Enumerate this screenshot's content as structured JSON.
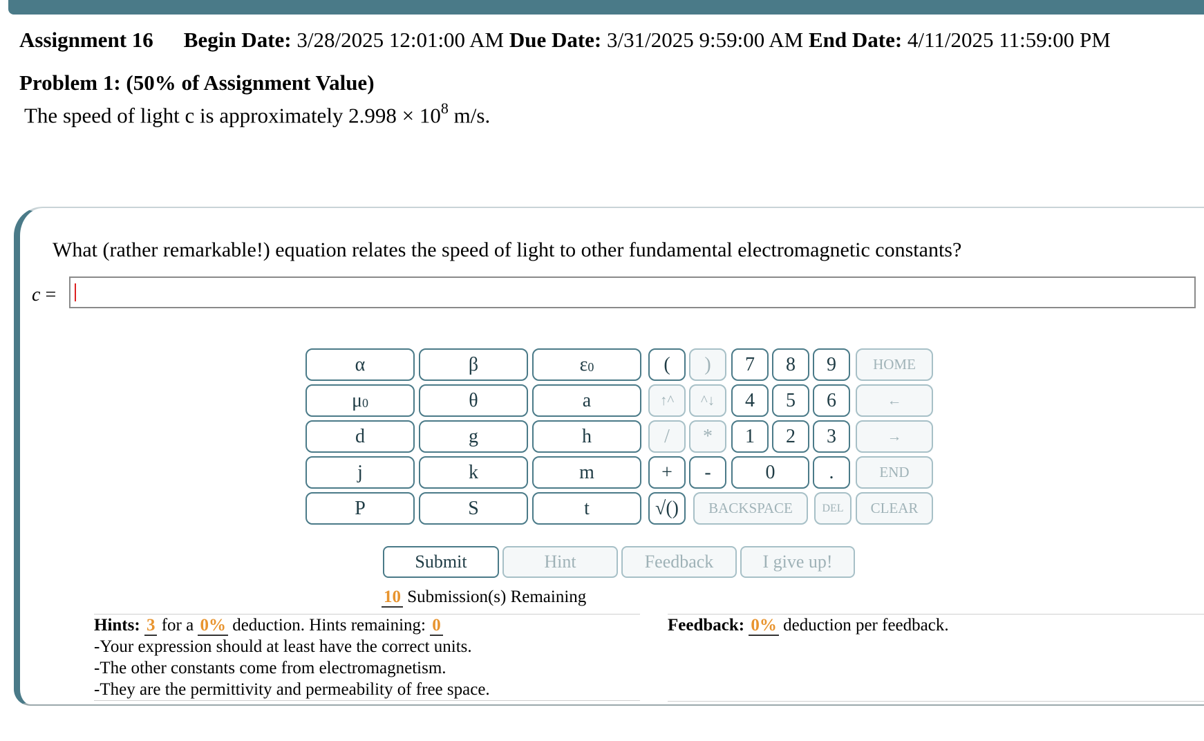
{
  "header": {
    "assignment": "Assignment 16",
    "begin_label": "Begin Date:",
    "begin_value": "3/28/2025 12:01:00 AM",
    "due_label": "Due Date:",
    "due_value": "3/31/2025 9:59:00 AM",
    "end_label": "End Date:",
    "end_value": "4/11/2025 11:59:00 PM"
  },
  "problem": {
    "title": "Problem 1: (50% of Assignment Value)",
    "text_before": "The speed of light c is approximately 2.998 × 10",
    "exponent": "8",
    "text_after": " m/s."
  },
  "question": {
    "text": "What (rather remarkable!) equation relates the speed of light to other fundamental electromagnetic constants?",
    "var": "c",
    "equals": " =",
    "answer_value": ""
  },
  "keypad": {
    "alpha": "α",
    "beta": "β",
    "eps": "ε",
    "eps_sub": "0",
    "mu": "μ",
    "mu_sub": "0",
    "theta": "θ",
    "a": "a",
    "d": "d",
    "g": "g",
    "h": "h",
    "j": "j",
    "k": "k",
    "m": "m",
    "P": "P",
    "S": "S",
    "t": "t",
    "lparen": "(",
    "rparen": ")",
    "up": "↑^",
    "down": "^↓",
    "slash": "/",
    "star": "*",
    "plus": "+",
    "minus": "-",
    "sqrt": "√()",
    "n7": "7",
    "n8": "8",
    "n9": "9",
    "n4": "4",
    "n5": "5",
    "n6": "6",
    "n1": "1",
    "n2": "2",
    "n3": "3",
    "n0": "0",
    "dot": ".",
    "home": "HOME",
    "left": "←",
    "right": "→",
    "end": "END",
    "backspace": "BACKSPACE",
    "del": "DEL",
    "clear": "CLEAR"
  },
  "buttons": {
    "submit": "Submit",
    "hint": "Hint",
    "feedback": "Feedback",
    "giveup": "I give up!"
  },
  "remaining": {
    "count": "10",
    "label": " Submission(s) Remaining"
  },
  "hints": {
    "label": "Hints:",
    "count": "3",
    "for_a": " for a ",
    "pct": "0%",
    "deduction": " deduction. Hints remaining: ",
    "remaining": "0",
    "items": [
      "-Your expression should at least have the correct units.",
      "-The other constants come from electromagnetism.",
      "-They are the permittivity and permeability of free space."
    ]
  },
  "feedback": {
    "label": "Feedback:",
    "pct": "0%",
    "text": " deduction per feedback."
  },
  "colors": {
    "accent": "#4a7a88",
    "highlight": "#e8942f",
    "caret": "#dd2222"
  }
}
